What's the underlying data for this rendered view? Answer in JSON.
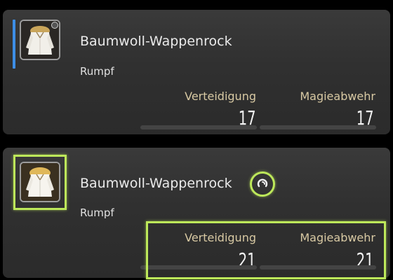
{
  "comparison": [
    {
      "item_name": "Baumwoll-Wappenrock",
      "category": "Rumpf",
      "stats": {
        "defense_label": "Verteidigung",
        "defense_value": "17",
        "magic_defense_label": "Magieabwehr",
        "magic_defense_value": "17"
      },
      "high_quality": false
    },
    {
      "item_name": "Baumwoll-Wappenrock",
      "category": "Rumpf",
      "stats": {
        "defense_label": "Verteidigung",
        "defense_value": "21",
        "magic_defense_label": "Magieabwehr",
        "magic_defense_value": "21"
      },
      "high_quality": true
    }
  ],
  "icons": {
    "item_icon": "tabard-icon",
    "quality_icon": "high-quality-icon"
  },
  "colors": {
    "highlight": "#bde85a",
    "selection_bar": "#3d8ee6",
    "stat_label": "#d8c9a3"
  }
}
